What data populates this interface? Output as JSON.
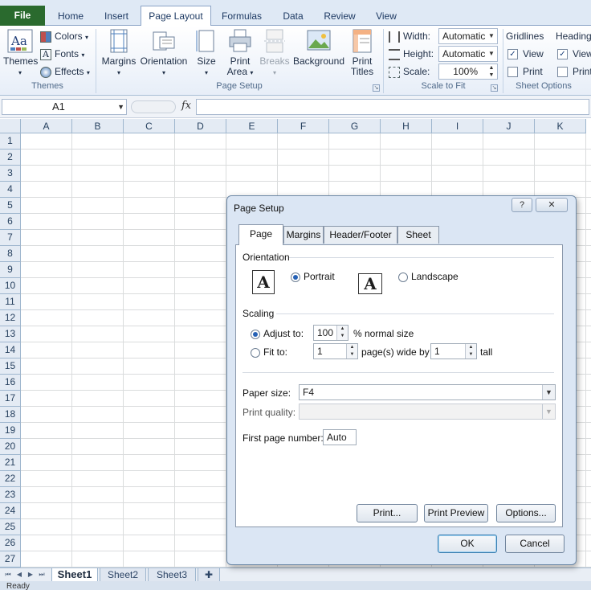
{
  "ribbon_tabs": {
    "file": "File",
    "home": "Home",
    "insert": "Insert",
    "page_layout": "Page Layout",
    "formulas": "Formulas",
    "data": "Data",
    "review": "Review",
    "view": "View"
  },
  "ribbon": {
    "themes": {
      "themes_btn": "Themes",
      "colors": "Colors",
      "fonts": "Fonts",
      "effects": "Effects",
      "group_label": "Themes"
    },
    "page_setup": {
      "margins": "Margins",
      "orientation": "Orientation",
      "size": "Size",
      "print_area_1": "Print",
      "print_area_2": "Area",
      "breaks": "Breaks",
      "background": "Background",
      "print_titles_1": "Print",
      "print_titles_2": "Titles",
      "group_label": "Page Setup"
    },
    "scale_to_fit": {
      "width_label": "Width:",
      "width_value": "Automatic",
      "height_label": "Height:",
      "height_value": "Automatic",
      "scale_label": "Scale:",
      "scale_value": "100%",
      "group_label": "Scale to Fit"
    },
    "sheet_options": {
      "gridlines": "Gridlines",
      "headings": "Heading",
      "view": "View",
      "print": "Print",
      "headings_view": "View",
      "headings_print": "Print",
      "group_label": "Sheet Options"
    }
  },
  "formula_bar": {
    "name_box": "A1",
    "fx": "fx",
    "formula": ""
  },
  "columns": [
    "A",
    "B",
    "C",
    "D",
    "E",
    "F",
    "G",
    "H",
    "I",
    "J",
    "K"
  ],
  "rows": [
    "1",
    "2",
    "3",
    "4",
    "5",
    "6",
    "7",
    "8",
    "9",
    "10",
    "11",
    "12",
    "13",
    "14",
    "15",
    "16",
    "17",
    "18",
    "19",
    "20",
    "21",
    "22",
    "23",
    "24",
    "25",
    "26",
    "27"
  ],
  "sheets": {
    "tabs": [
      "Sheet1",
      "Sheet2",
      "Sheet3"
    ],
    "active": "Sheet1"
  },
  "status": {
    "text": "Ready"
  },
  "dialog": {
    "title": "Page Setup",
    "help": "?",
    "close": "✕",
    "tabs": {
      "page": "Page",
      "margins": "Margins",
      "header_footer": "Header/Footer",
      "sheet": "Sheet"
    },
    "orientation": {
      "title": "Orientation",
      "portrait": "Portrait",
      "landscape": "Landscape",
      "icon_letter": "A"
    },
    "scaling": {
      "title": "Scaling",
      "adjust_to": "Adjust to:",
      "adjust_value": "100",
      "normal_size": "% normal size",
      "fit_to": "Fit to:",
      "fit_wide": "1",
      "wide_by": "page(s) wide by",
      "fit_tall": "1",
      "tall": "tall"
    },
    "paper_size_label": "Paper size:",
    "paper_size_value": "F4",
    "print_quality_label": "Print quality:",
    "print_quality_value": "",
    "first_page_label": "First page number:",
    "first_page_value": "Auto",
    "buttons": {
      "print": "Print...",
      "print_preview": "Print Preview",
      "options": "Options...",
      "ok": "OK",
      "cancel": "Cancel"
    }
  }
}
